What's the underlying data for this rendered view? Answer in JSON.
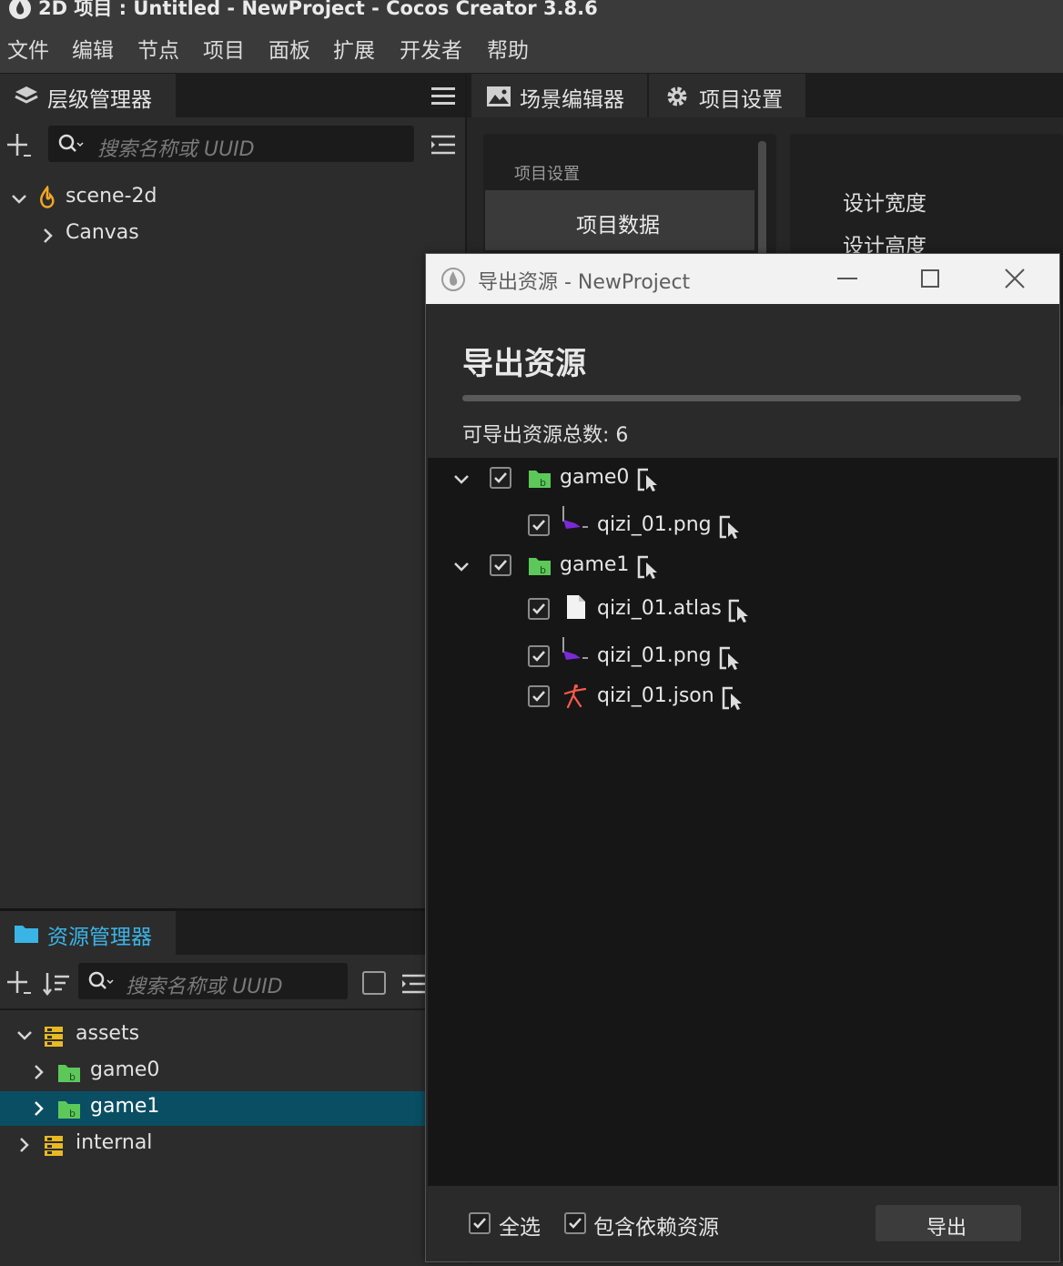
{
  "window": {
    "title": "2D 项目 : Untitled - NewProject - Cocos Creator 3.8.6"
  },
  "menu": [
    "文件",
    "编辑",
    "节点",
    "项目",
    "面板",
    "扩展",
    "开发者",
    "帮助"
  ],
  "hierarchy": {
    "tab_label": "层级管理器",
    "search_placeholder": "搜索名称或 UUID",
    "tree": [
      {
        "label": "scene-2d",
        "expanded": true
      },
      {
        "label": "Canvas",
        "expanded": false
      }
    ]
  },
  "center": {
    "tabs": [
      {
        "label": "场景编辑器"
      },
      {
        "label": "项目设置"
      }
    ],
    "settings_nav": {
      "header": "项目设置",
      "active_item": "项目数据"
    },
    "settings_fields": [
      "设计宽度",
      "设计高度"
    ]
  },
  "assets_panel": {
    "tab_label": "资源管理器",
    "search_placeholder": "搜索名称或 UUID",
    "tree": [
      {
        "label": "assets",
        "type": "db",
        "expanded": true
      },
      {
        "label": "game0",
        "type": "bundle",
        "expanded": false
      },
      {
        "label": "game1",
        "type": "bundle",
        "expanded": false,
        "selected": true
      },
      {
        "label": "internal",
        "type": "db",
        "expanded": false
      }
    ]
  },
  "dialog": {
    "window_title": "导出资源 - NewProject",
    "heading": "导出资源",
    "count_label": "可导出资源总数: 6",
    "items": [
      {
        "label": "game0",
        "kind": "folder",
        "checked": true
      },
      {
        "label": "qizi_01.png",
        "kind": "png",
        "checked": true
      },
      {
        "label": "game1",
        "kind": "folder",
        "checked": true
      },
      {
        "label": "qizi_01.atlas",
        "kind": "file",
        "checked": true
      },
      {
        "label": "qizi_01.png",
        "kind": "png",
        "checked": true
      },
      {
        "label": "qizi_01.json",
        "kind": "spine",
        "checked": true
      }
    ],
    "footer": {
      "select_all_label": "全选",
      "select_all_checked": true,
      "include_deps_label": "包含依赖资源",
      "include_deps_checked": true,
      "export_button": "导出"
    }
  },
  "colors": {
    "accent_blue": "#3ab4e6",
    "selection": "#0a4e63",
    "bundle_green": "#5cc85a",
    "db_yellow": "#e8b923",
    "scene_orange": "#f5a623"
  }
}
